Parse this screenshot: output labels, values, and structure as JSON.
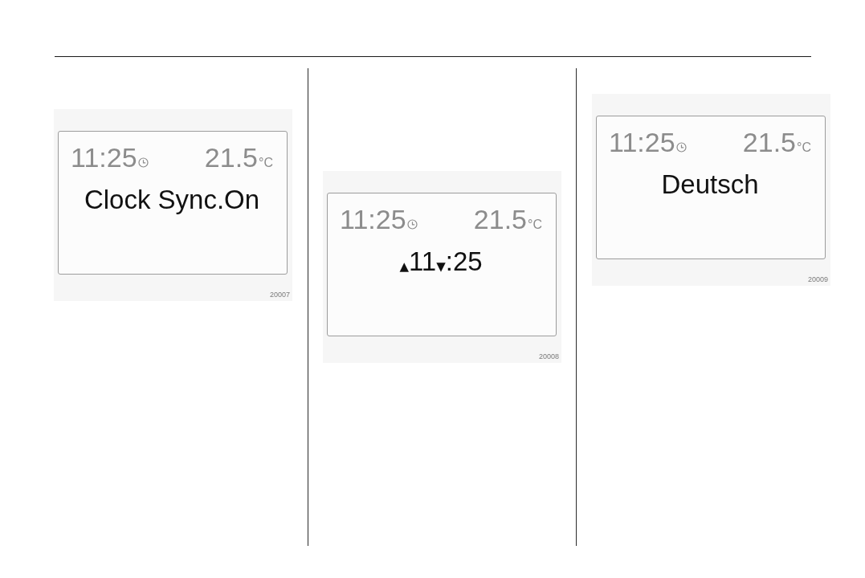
{
  "figures": [
    {
      "display": {
        "time": "11:25",
        "temperature": "21.5",
        "unit": "°C",
        "message": [
          {
            "kind": "text",
            "text": "Clock Sync.On"
          }
        ]
      },
      "number": "20007"
    },
    {
      "display": {
        "time": "11:25",
        "temperature": "21.5",
        "unit": "°C",
        "message": [
          {
            "kind": "symbol",
            "text": "▲"
          },
          {
            "kind": "text",
            "text": "11"
          },
          {
            "kind": "symbol",
            "text": "▼"
          },
          {
            "kind": "text",
            "text": ":25"
          }
        ]
      },
      "number": "20008"
    },
    {
      "display": {
        "time": "11:25",
        "temperature": "21.5",
        "unit": "°C",
        "message": [
          {
            "kind": "text",
            "text": "Deutsch"
          }
        ]
      },
      "number": "20009"
    }
  ]
}
